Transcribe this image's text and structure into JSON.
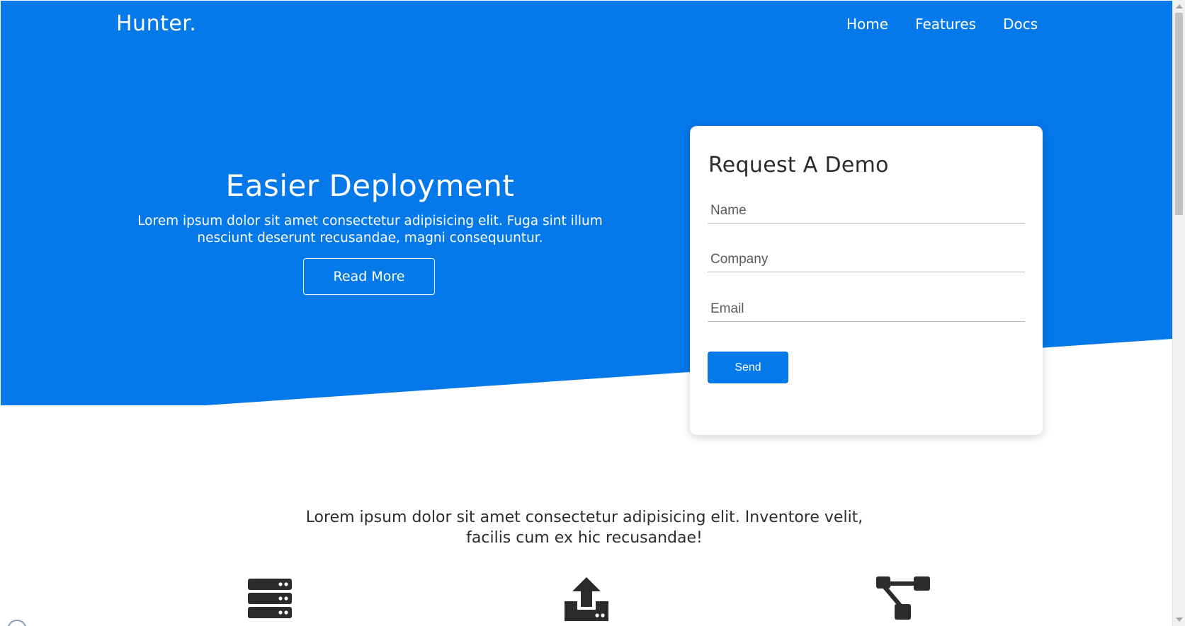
{
  "header": {
    "brand": "Hunter.",
    "nav": [
      "Home",
      "Features",
      "Docs"
    ]
  },
  "hero": {
    "title": "Easier Deployment",
    "subtitle": "Lorem ipsum dolor sit amet consectetur adipisicing elit. Fuga sint illum nesciunt deserunt recusandae, magni consequuntur.",
    "button_label": "Read More"
  },
  "demo_form": {
    "title": "Request A Demo",
    "name_placeholder": "Name",
    "company_placeholder": "Company",
    "email_placeholder": "Email",
    "send_label": "Send"
  },
  "intro": {
    "text": "Lorem ipsum dolor sit amet consectetur adipisicing elit. Inventore velit, facilis cum ex hic recusandae!"
  },
  "features": {
    "icons": [
      "server-icon",
      "upload-icon",
      "network-icon"
    ]
  },
  "colors": {
    "brand_blue": "#0578ea",
    "icon_dark": "#2b2b2b"
  }
}
